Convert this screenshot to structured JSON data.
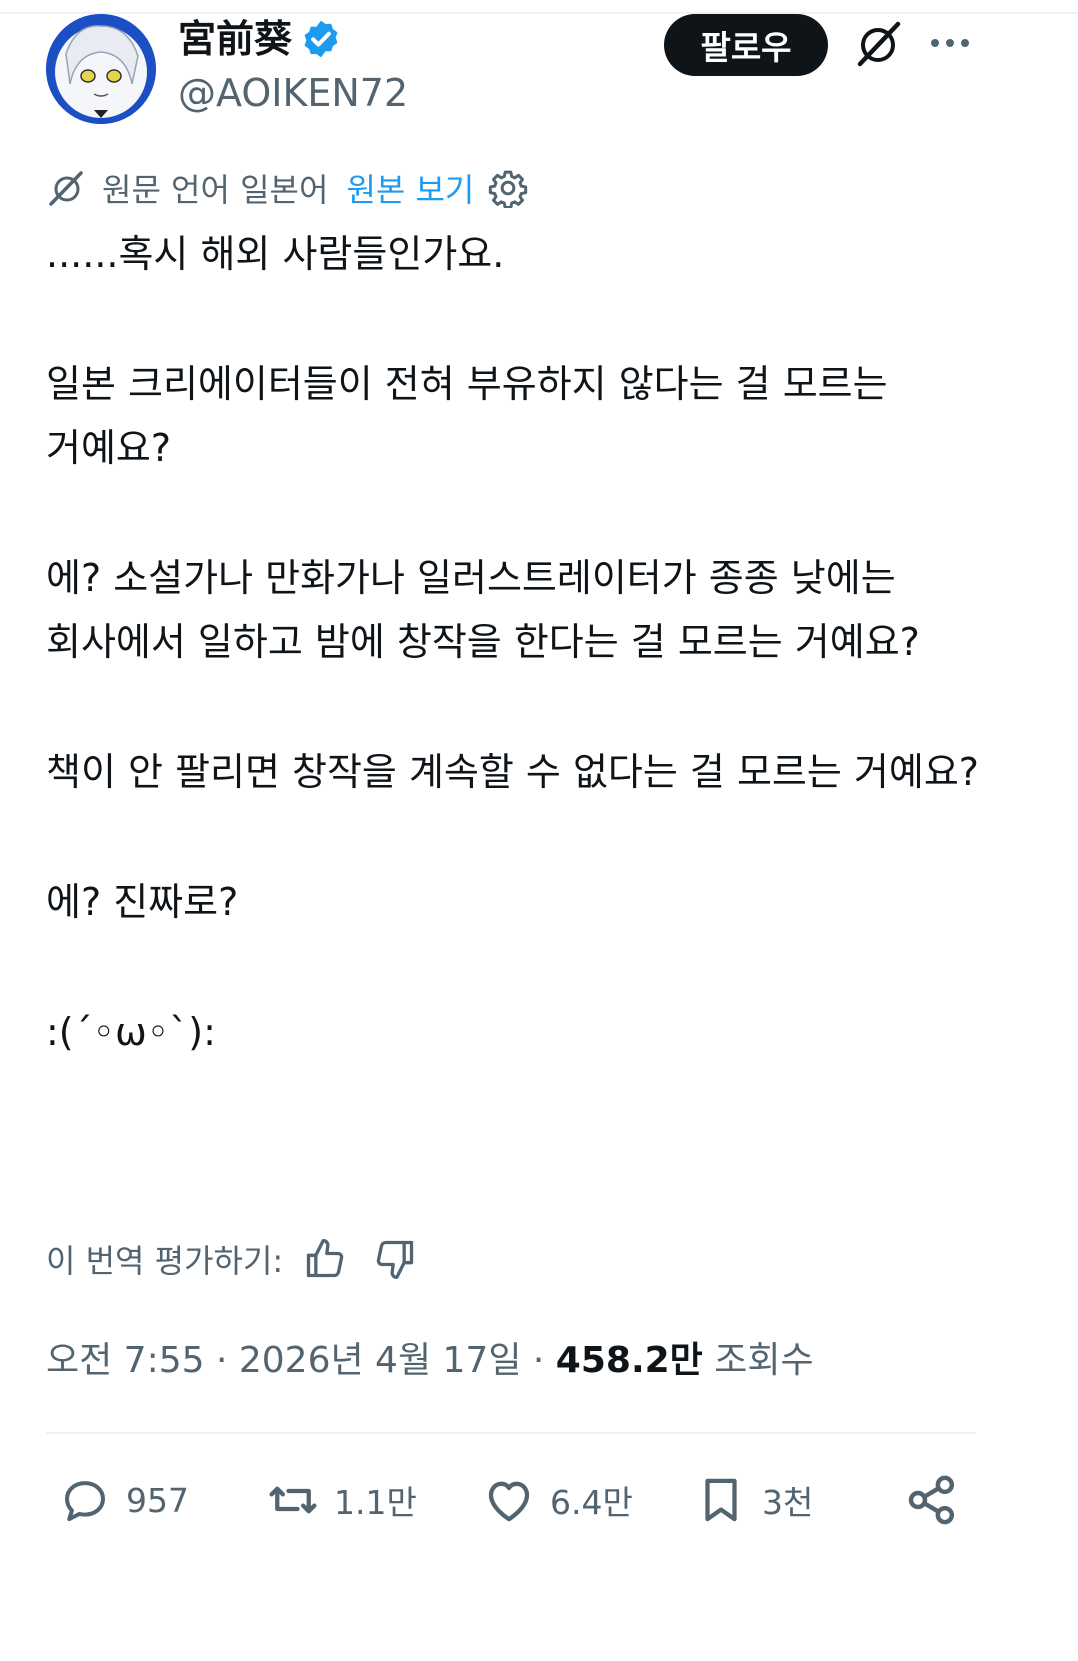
{
  "author": {
    "display_name": "宮前葵",
    "handle": "@AOIKEN72",
    "verified_icon": "verified-badge-icon",
    "accent": "#1d9bf0"
  },
  "header": {
    "follow_label": "팔로우",
    "grok_icon": "grok-icon",
    "more_icon": "more-icon"
  },
  "translation": {
    "source_label": "원문 언어 일본어",
    "show_original_label": "원본 보기",
    "rate_label": "이 번역 평가하기:"
  },
  "tweet": {
    "paragraphs": [
      "......혹시 해외 사람들인가요.",
      "일본 크리에이터들이 전혀 부유하지 않다는 걸 모르는 거예요?",
      "에? 소설가나 만화가나 일러스트레이터가 종종 낮에는 회사에서 일하고 밤에 창작을 한다는 걸 모르는 거예요?",
      "책이 안 팔리면 창작을 계속할 수 없다는 걸 모르는 거예요?",
      "에? 진짜로?",
      ":(´◦ω◦`):"
    ]
  },
  "meta": {
    "time": "오전 7:55",
    "date": "2026년 4월 17일",
    "views_count": "458.2만",
    "views_label": "조회수"
  },
  "actions": {
    "replies": "957",
    "reposts": "1.1만",
    "likes": "6.4만",
    "bookmarks": "3천"
  }
}
